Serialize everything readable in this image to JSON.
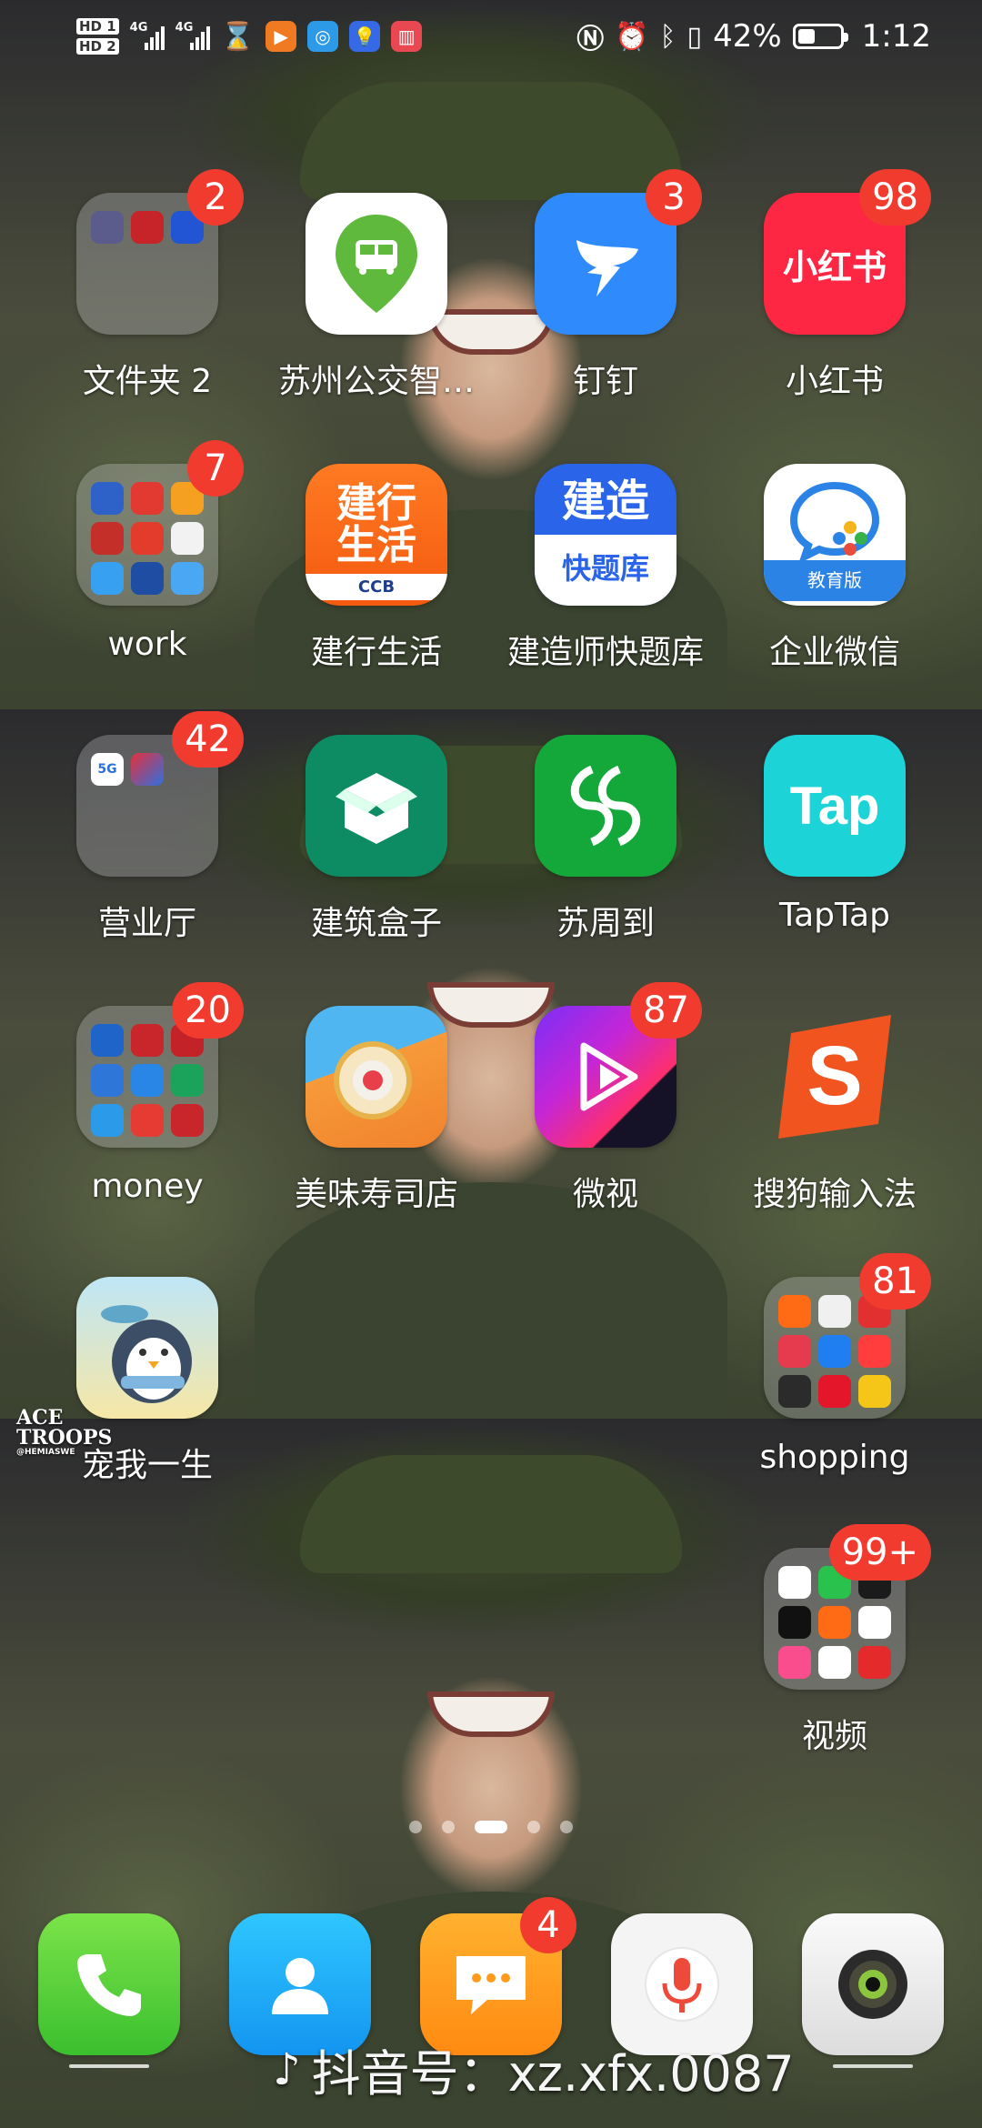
{
  "status_bar": {
    "hd1": "HD 1",
    "hd2": "HD 2",
    "net1": "4G",
    "net2": "4G",
    "battery_text": "42%",
    "battery_level": 0.42,
    "time": "1:12"
  },
  "apps": [
    {
      "label": "文件夹 2",
      "badge": "2"
    },
    {
      "label": "苏州公交智…",
      "badge": ""
    },
    {
      "label": "钉钉",
      "badge": "3"
    },
    {
      "label": "小红书",
      "badge": "98"
    },
    {
      "label": "work",
      "badge": "7"
    },
    {
      "label": "建行生活",
      "badge": ""
    },
    {
      "label": "建造师快题库",
      "badge": ""
    },
    {
      "label": "企业微信",
      "badge": ""
    },
    {
      "label": "营业厅",
      "badge": "42"
    },
    {
      "label": "建筑盒子",
      "badge": ""
    },
    {
      "label": "苏周到",
      "badge": ""
    },
    {
      "label": "TapTap",
      "badge": ""
    },
    {
      "label": "money",
      "badge": "20"
    },
    {
      "label": "美味寿司店",
      "badge": ""
    },
    {
      "label": "微视",
      "badge": "87"
    },
    {
      "label": "搜狗输入法",
      "badge": ""
    },
    {
      "label": "宠我一生",
      "badge": ""
    },
    {
      "label": "shopping",
      "badge": "81"
    },
    {
      "label": "视频",
      "badge": "99+"
    }
  ],
  "icon_text": {
    "xiaohongshu": "小红书",
    "jianhang_1": "建行",
    "jianhang_2": "生活",
    "jianhang_ccb": "CCB",
    "jianzao_1": "建造",
    "jianzao_2": "快题库",
    "wecom_edu": "教育版",
    "taptap": "Tap",
    "fiveg": "5G"
  },
  "dock": {
    "messages_badge": "4"
  },
  "watermark": {
    "text": "抖音号：xz.xfx.0087"
  },
  "wallpaper_text": {
    "ace": "ACE",
    "troops": "TROOPS",
    "handle": "@HEMIASWE"
  }
}
